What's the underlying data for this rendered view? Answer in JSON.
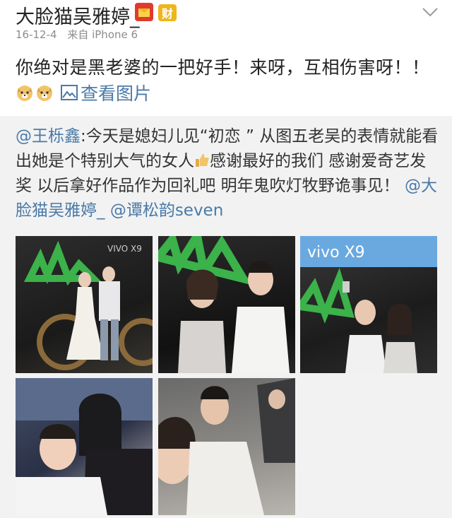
{
  "post": {
    "username": "大脸猫吴雅婷_",
    "badge_gold_label": "财",
    "date": "16-12-4",
    "source": "来自 iPhone 6",
    "content": "你绝对是黑老婆的一把好手！来呀，互相伤害呀！！",
    "view_images_label": "查看图片"
  },
  "repost": {
    "author": "@王栎鑫",
    "text_part1": ":今天是媳妇儿见“初恋 ” 从图五老吴的表情就能看出她是个特别大气的女人",
    "text_part2": "感谢最好的我们 感谢爱奇艺发奖 以后拿好作品作为回礼吧 明年鬼吹灯牧野诡事见！",
    "mention1": "@大脸猫吴雅婷_",
    "mention2": "@谭松韵seven"
  },
  "photos": {
    "p1_text": "VIVO X9",
    "p3_text": "vivo X9"
  }
}
